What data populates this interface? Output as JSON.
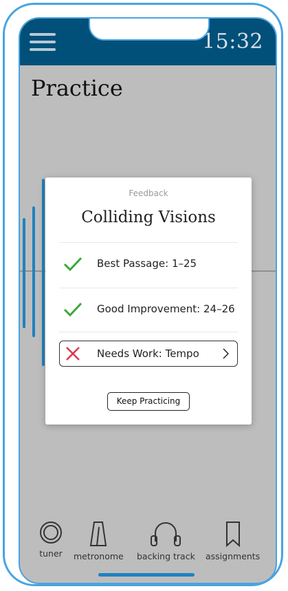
{
  "status_bar": {
    "time": "15:32",
    "menu_icon": "hamburger-menu-icon"
  },
  "page": {
    "title": "Practice"
  },
  "feedback_modal": {
    "label": "Feedback",
    "title": "Colliding Visions",
    "items": [
      {
        "text": "Best Passage: 1–25",
        "status": "good",
        "icon": "check-icon"
      },
      {
        "text": "Good Improvement: 24–26",
        "status": "good",
        "icon": "check-icon"
      },
      {
        "text": "Needs Work: Tempo",
        "status": "bad",
        "icon": "cross-icon"
      }
    ],
    "button_label": "Keep Practicing"
  },
  "tab_bar": {
    "tabs": [
      {
        "label": "tuner",
        "icon": "tuner-icon"
      },
      {
        "label": "metronome",
        "icon": "metronome-icon"
      },
      {
        "label": "backing track",
        "icon": "headphones-icon"
      },
      {
        "label": "assignments",
        "icon": "bookmark-icon"
      }
    ]
  },
  "colors": {
    "status_bar": "#01507a",
    "accent": "#1f82c0",
    "phone_outline": "#4aa3df",
    "check": "#3aa83a",
    "cross": "#e0344a"
  }
}
